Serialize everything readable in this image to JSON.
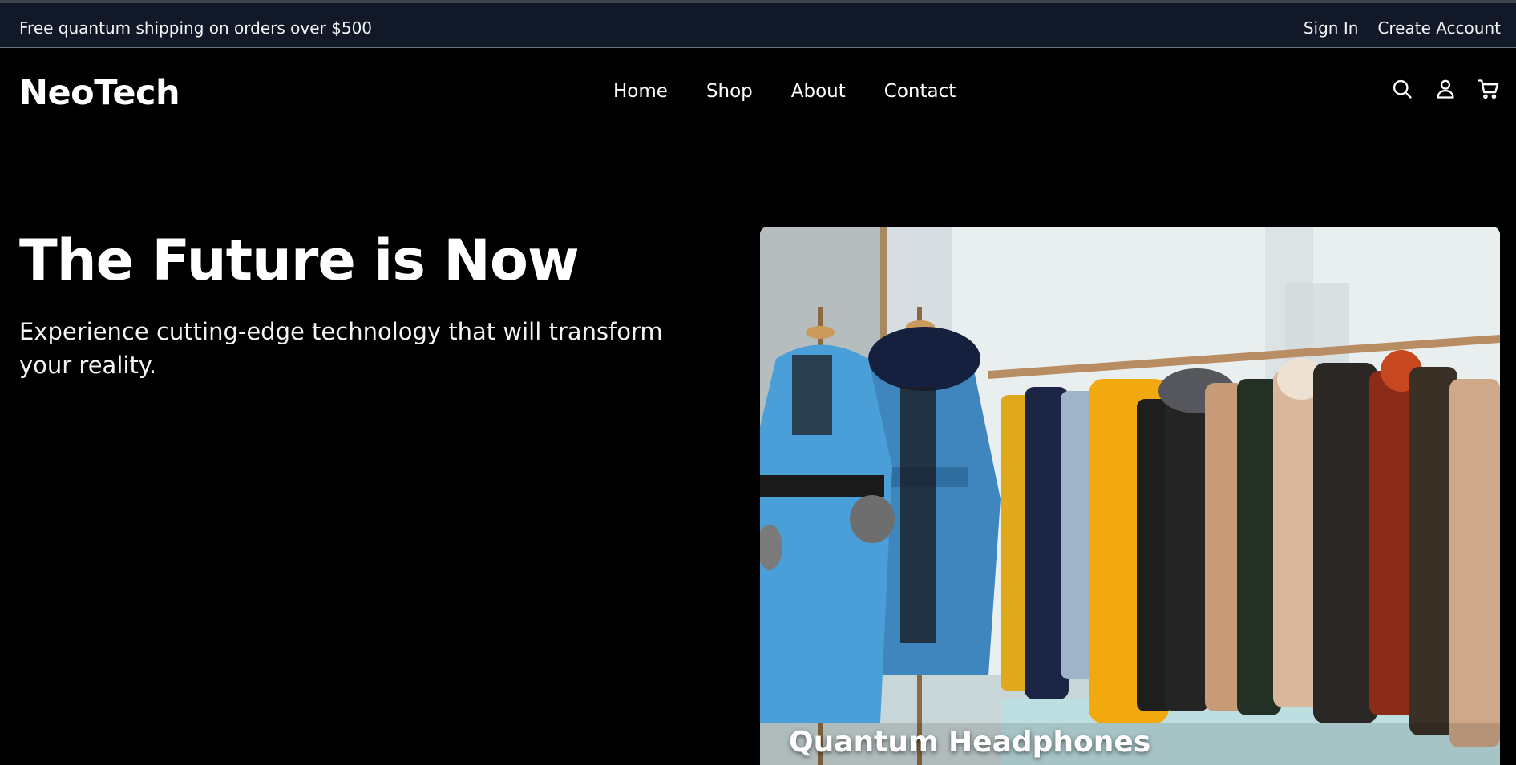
{
  "topbar": {
    "promo": "Free quantum shipping on orders over $500",
    "sign_in": "Sign In",
    "create_account": "Create Account"
  },
  "header": {
    "logo": "NeoTech",
    "nav": [
      "Home",
      "Shop",
      "About",
      "Contact"
    ],
    "icons": [
      "search-icon",
      "user-icon",
      "cart-icon"
    ]
  },
  "hero": {
    "title": "The Future is Now",
    "subtitle": "Experience cutting-edge technology that will transform your reality.",
    "card_caption": "Quantum Headphones"
  },
  "colors": {
    "background": "#000000",
    "topbar": "#111827",
    "text": "#ffffff"
  }
}
